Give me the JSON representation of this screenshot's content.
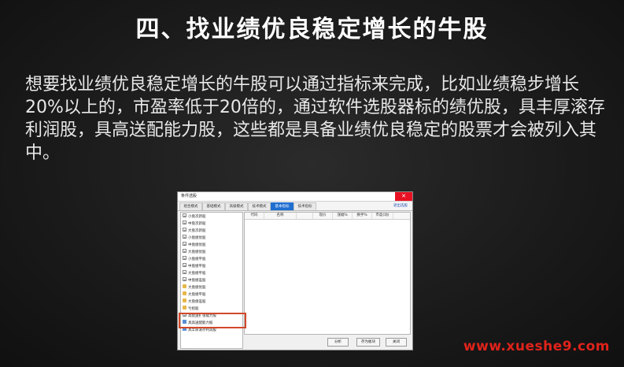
{
  "slide": {
    "title": "四、找业绩优良稳定增长的牛股",
    "body": "想要找业绩优良稳定增长的牛股可以通过指标来完成，比如业绩稳步增长20%以上的，市盈率低于20倍的，通过软件选股器标的绩优股，具丰厚滚存利润股，具高送配能力股，这些都是具备业绩优良稳定的股票才会被列入其中。"
  },
  "window": {
    "title": "条件选股",
    "close_glyph": "✕",
    "tabs": [
      "组合模式",
      "基础模式",
      "高级模式",
      "技术模式",
      "基本指标",
      "技术指标"
    ],
    "active_tab_index": 4,
    "exit_label": "退出选股",
    "tree_items": [
      {
        "label": "小盘次新股",
        "icon": "plus-icon"
      },
      {
        "label": "中盘次新股",
        "icon": "plus-icon"
      },
      {
        "label": "大盘次新股",
        "icon": "plus-icon"
      },
      {
        "label": "小盘绩优股",
        "icon": "plus-icon"
      },
      {
        "label": "中盘绩优股",
        "icon": "plus-icon"
      },
      {
        "label": "大盘绩优股",
        "icon": "plus-icon"
      },
      {
        "label": "小盘绩平股",
        "icon": "plus-icon"
      },
      {
        "label": "中盘绩平股",
        "icon": "plus-icon"
      },
      {
        "label": "大盘绩平股",
        "icon": "plus-icon"
      },
      {
        "label": "中盘绩差股",
        "icon": "plus-icon"
      },
      {
        "label": "大盘绩优股",
        "icon": "folder-icon"
      },
      {
        "label": "大盘绩平股",
        "icon": "folder-icon"
      },
      {
        "label": "大盘绩差股",
        "icon": "folder-icon"
      },
      {
        "label": "亏损股",
        "icon": "folder-icon"
      },
      {
        "label": "高配送扩张能力股",
        "icon": "plus-icon"
      },
      {
        "label": "具高送配能力股",
        "icon": "chart-icon"
      },
      {
        "label": "具丰厚滚存利润股",
        "icon": "chart-icon"
      }
    ],
    "grid_columns": [
      "代码",
      "名称",
      "",
      "现价",
      "涨幅%",
      "换手%",
      "市盈(动)"
    ],
    "buttons": {
      "analyze": "分析",
      "save": "存为板块",
      "close": "关闭"
    }
  },
  "watermark": "www.xueshe9.com",
  "colors": {
    "highlight": "#d2492a",
    "active_tab": "#1f6fd0",
    "watermark": "#e0231b"
  }
}
